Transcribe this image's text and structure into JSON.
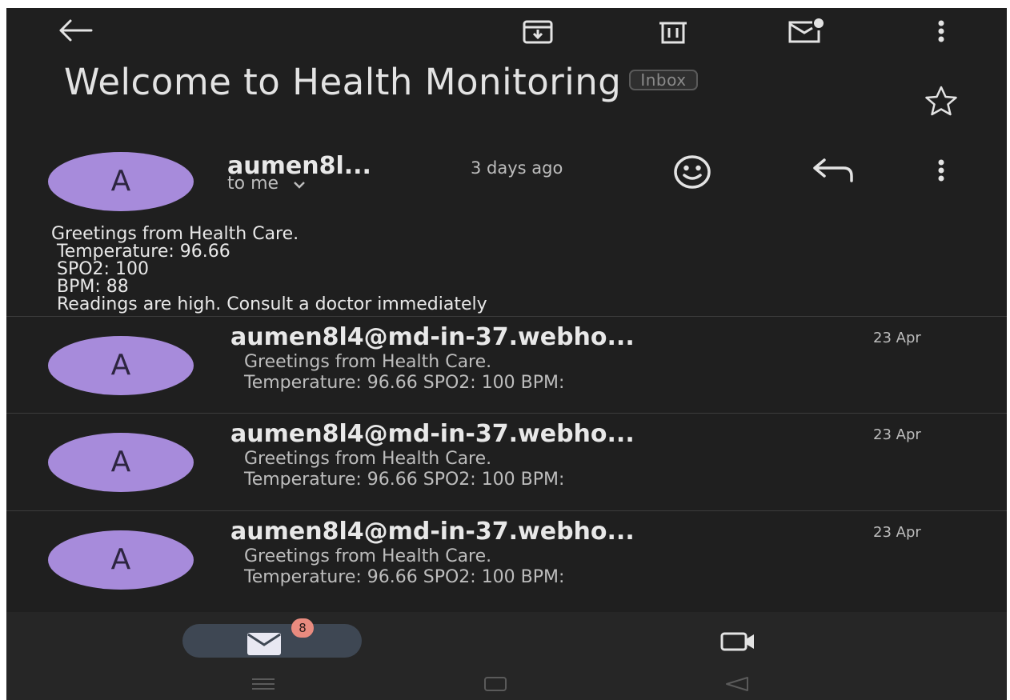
{
  "toolbar": {
    "icons": [
      "back-arrow-icon",
      "archive-icon",
      "delete-icon",
      "mark-unread-icon",
      "more-vert-icon"
    ]
  },
  "email": {
    "subject": "Welcome to Health Monitoring",
    "label": "Inbox",
    "sender": "aumen8l...",
    "time": "3 days ago",
    "recipient": "to me",
    "body": [
      "Greetings from Health Care.",
      " Temperature: 96.66",
      " SPO2: 100",
      " BPM: 88",
      " Readings are high. Consult a doctor immediately"
    ]
  },
  "avatar_letter": "A",
  "thread": [
    {
      "sender": "aumen8l4@md-in-37.webho...",
      "date": "23 Apr",
      "snippet_line1": "Greetings from Health Care.",
      "snippet_line2": "Temperature: 96.66 SPO2: 100 BPM:"
    },
    {
      "sender": "aumen8l4@md-in-37.webho...",
      "date": "23 Apr",
      "snippet_line1": "Greetings from Health Care.",
      "snippet_line2": "Temperature: 96.66 SPO2: 100 BPM:"
    },
    {
      "sender": "aumen8l4@md-in-37.webho...",
      "date": "23 Apr",
      "snippet_line1": "Greetings from Health Care.",
      "snippet_line2": "Temperature: 96.66 SPO2: 100 BPM:"
    }
  ],
  "bottom_nav": {
    "mail_badge": "8",
    "icons": [
      "mail-icon",
      "video-icon"
    ]
  },
  "colors": {
    "background": "#1f1f1f",
    "avatar": "#a78bdb",
    "badge": "#e98b7f",
    "active_pill": "#3e4753"
  }
}
